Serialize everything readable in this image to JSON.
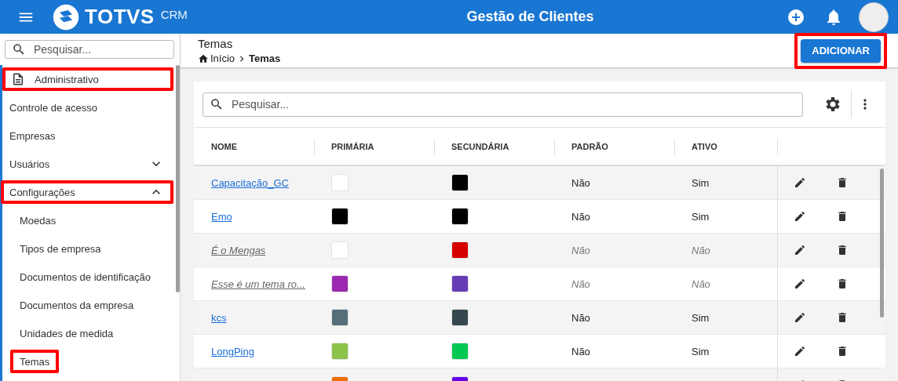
{
  "app_bar": {
    "brand": "TOTVS",
    "product": "CRM",
    "title": "Gestão de Clientes"
  },
  "sidebar": {
    "search": {
      "placeholder": "Pesquisar..."
    },
    "items": [
      {
        "label": "Administrativo",
        "kind": "section",
        "highlighted": true
      },
      {
        "label": "Controle de acesso",
        "kind": "item",
        "highlighted": false
      },
      {
        "label": "Empresas",
        "kind": "item",
        "highlighted": false
      },
      {
        "label": "Usuários",
        "kind": "group",
        "expanded": false,
        "highlighted": false
      },
      {
        "label": "Configurações",
        "kind": "group",
        "expanded": true,
        "highlighted": true,
        "children": [
          {
            "label": "Moedas",
            "highlighted": false
          },
          {
            "label": "Tipos de empresa",
            "highlighted": false
          },
          {
            "label": "Documentos de identificação",
            "highlighted": false
          },
          {
            "label": "Documentos da empresa",
            "highlighted": false
          },
          {
            "label": "Unidades de medida",
            "highlighted": false
          },
          {
            "label": "Temas",
            "highlighted": true
          }
        ]
      }
    ]
  },
  "page": {
    "title": "Temas",
    "breadcrumb": [
      "Início",
      "Temas"
    ],
    "add_button": {
      "label": "ADICIONAR",
      "highlighted": true
    }
  },
  "table": {
    "search": {
      "placeholder": "Pesquisar..."
    },
    "columns": [
      "NOME",
      "PRIMÁRIA",
      "SECUNDÁRIA",
      "PADRÃO",
      "ATIVO"
    ],
    "rows": [
      {
        "name": "Capacitação_GC",
        "primary": {
          "color": "#ffffff"
        },
        "secondary": {
          "color": "#000000"
        },
        "default": "Não",
        "active_text": "Sim",
        "inactive": false
      },
      {
        "name": "Emo",
        "primary": {
          "color": "#000000"
        },
        "secondary": {
          "color": "#000000"
        },
        "default": "Não",
        "active_text": "Sim",
        "inactive": false
      },
      {
        "name": "É o Mengas",
        "primary": {
          "color": "#ffffff"
        },
        "secondary": {
          "color": "#d50000"
        },
        "default": "Não",
        "active_text": "Não",
        "inactive": true
      },
      {
        "name": "Esse é um tema ro...",
        "primary": {
          "color": "#9c27b0"
        },
        "secondary": {
          "color": "#673ab7"
        },
        "default": "Não",
        "active_text": "Não",
        "inactive": true
      },
      {
        "name": "kcs",
        "primary": {
          "color": "#546e7a"
        },
        "secondary": {
          "color": "#37474f"
        },
        "default": "Não",
        "active_text": "Sim",
        "inactive": false
      },
      {
        "name": "LongPing",
        "primary": {
          "color": "#8bc34a"
        },
        "secondary": {
          "color": "#00c853"
        },
        "default": "Não",
        "active_text": "Sim",
        "inactive": false
      },
      {
        "primary": {
          "color": "#ef6c00"
        },
        "secondary": {
          "color": "#6200ea"
        }
      }
    ]
  }
}
